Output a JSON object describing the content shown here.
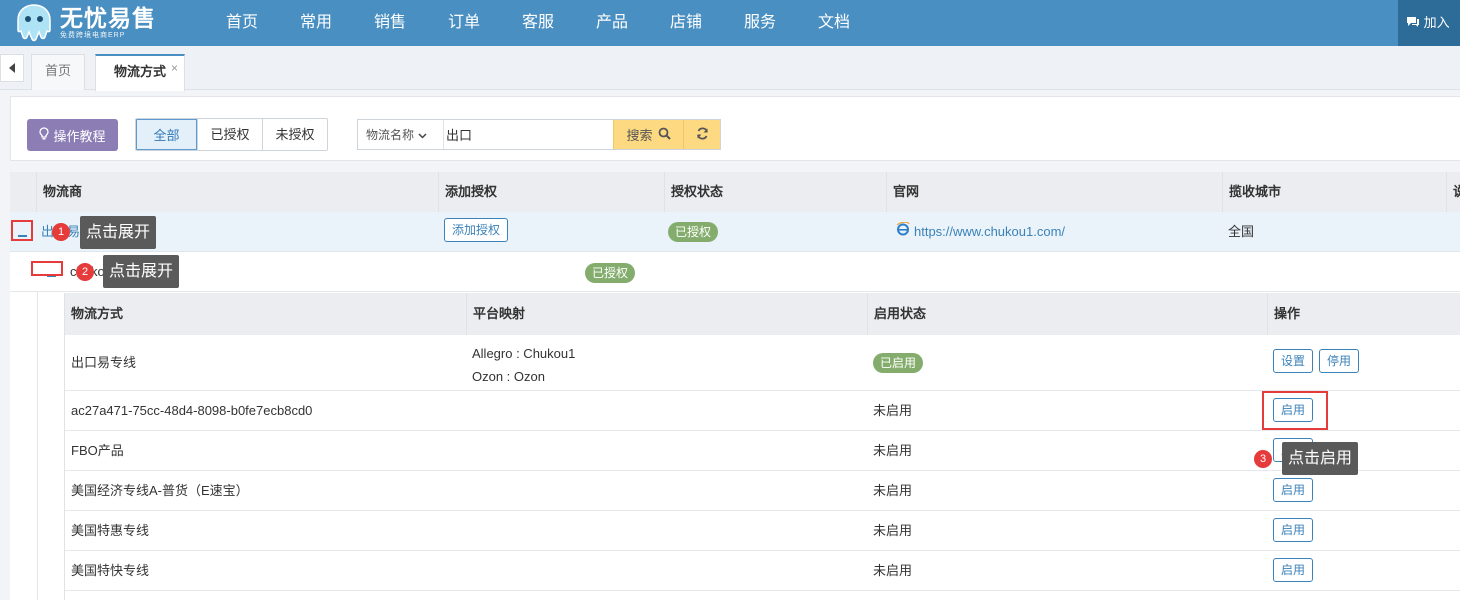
{
  "app": {
    "title": "无忧易售",
    "subtitle": "免费跨境电商ERP"
  },
  "nav": {
    "items": [
      "首页",
      "常用",
      "销售",
      "订单",
      "客服",
      "产品",
      "店铺",
      "服务",
      "文档"
    ],
    "join_label": "加入"
  },
  "tabs": [
    {
      "label": "首页",
      "active": false
    },
    {
      "label": "物流方式",
      "active": true,
      "close": "×"
    }
  ],
  "toolbar": {
    "tutorial_label": "操作教程",
    "filters": [
      "全部",
      "已授权",
      "未授权"
    ],
    "select_value": "物流名称",
    "search_value": "出口",
    "search_label": "搜索"
  },
  "table": {
    "headers": [
      "物流商",
      "添加授权",
      "授权状态",
      "官网",
      "揽收城市",
      "说"
    ],
    "provider": {
      "name": "出口易",
      "add_auth_label": "添加授权",
      "status": "已授权",
      "website": "https://www.chukou1.com/",
      "city": "全国"
    },
    "account": {
      "name": "chukou1",
      "status": "已授权"
    }
  },
  "subtable": {
    "headers": [
      "物流方式",
      "平台映射",
      "启用状态",
      "操作"
    ],
    "rows": [
      {
        "name": "出口易专线",
        "mapping": [
          "Allegro : Chukou1",
          "Ozon : Ozon"
        ],
        "status": "已启用",
        "actions": [
          "设置",
          "停用"
        ]
      },
      {
        "name": "ac27a471-75cc-48d4-8098-b0fe7ecb8cd0",
        "mapping": [],
        "status": "未启用",
        "actions": [
          "启用"
        ]
      },
      {
        "name": "FBO产品",
        "mapping": [],
        "status": "未启用",
        "actions": [
          "启用"
        ]
      },
      {
        "name": "美国经济专线A-普货（E速宝）",
        "mapping": [],
        "status": "未启用",
        "actions": [
          "启用"
        ]
      },
      {
        "name": "美国特惠专线",
        "mapping": [],
        "status": "未启用",
        "actions": [
          "启用"
        ]
      },
      {
        "name": "美国特快专线",
        "mapping": [],
        "status": "未启用",
        "actions": [
          "启用"
        ]
      }
    ]
  },
  "callouts": [
    {
      "num": "1",
      "text": "点击展开"
    },
    {
      "num": "2",
      "text": "点击展开"
    },
    {
      "num": "3",
      "text": "点击启用"
    }
  ],
  "colors": {
    "nav_bg": "#4a8fc1",
    "tutorial_bg": "#8c7db5",
    "badge_green": "#84ad6d",
    "search_yellow": "#fdd981",
    "annotation_red": "#e53b3b",
    "link_blue": "#3b82b9"
  }
}
